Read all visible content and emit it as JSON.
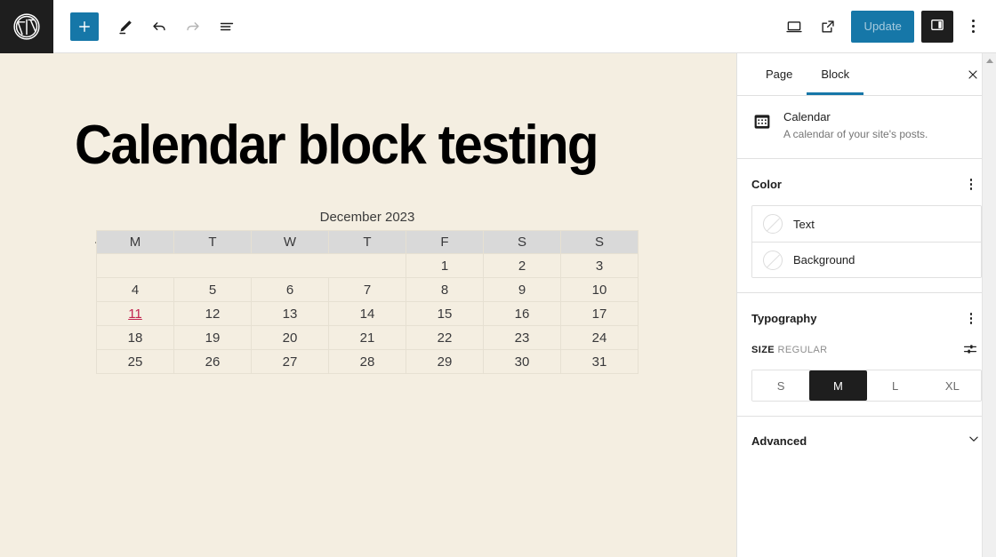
{
  "topbar": {
    "logo_icon": "wordpress-logo-icon",
    "inserter_label": "+",
    "inserter_icon": "plus-icon",
    "tools_icon": "pencil-edit-icon",
    "undo_icon": "undo-arrow-icon",
    "redo_icon": "redo-arrow-icon",
    "list_view_icon": "document-overview-icon",
    "preview_icon": "desktop-preview-icon",
    "view_icon": "external-link-icon",
    "update_label": "Update",
    "sidebar_toggle_icon": "sidebar-panel-icon",
    "options_icon": "three-dots-vertical-icon"
  },
  "canvas": {
    "post_title": "Calendar block testing",
    "paragraph": ".",
    "calendar": {
      "caption": "December 2023",
      "day_headers": [
        "M",
        "T",
        "W",
        "T",
        "F",
        "S",
        "S"
      ],
      "weeks": [
        [
          "",
          "",
          "",
          "",
          "1",
          "2",
          "3"
        ],
        [
          "4",
          "5",
          "6",
          "7",
          "8",
          "9",
          "10"
        ],
        [
          "11",
          "12",
          "13",
          "14",
          "15",
          "16",
          "17"
        ],
        [
          "18",
          "19",
          "20",
          "21",
          "22",
          "23",
          "24"
        ],
        [
          "25",
          "26",
          "27",
          "28",
          "29",
          "30",
          "31"
        ]
      ],
      "linked_day": "11",
      "link_color": "#c2234f",
      "header_bg": "#d9d9d9"
    }
  },
  "sidebar": {
    "tabs": [
      {
        "label": "Page",
        "active": false
      },
      {
        "label": "Block",
        "active": true
      }
    ],
    "close_icon": "close-x-icon",
    "block": {
      "icon": "calendar-icon",
      "name": "Calendar",
      "description": "A calendar of your site's posts."
    },
    "color_panel": {
      "title": "Color",
      "options_icon": "three-dots-vertical-icon",
      "items": [
        {
          "label": "Text",
          "swatch": "none"
        },
        {
          "label": "Background",
          "swatch": "none"
        }
      ]
    },
    "typography_panel": {
      "title": "Typography",
      "options_icon": "three-dots-vertical-icon",
      "size_key": "SIZE",
      "size_value": "REGULAR",
      "slider_icon": "sliders-toggle-icon",
      "sizes": [
        {
          "label": "S",
          "selected": false
        },
        {
          "label": "M",
          "selected": true
        },
        {
          "label": "L",
          "selected": false
        },
        {
          "label": "XL",
          "selected": false
        }
      ]
    },
    "advanced_panel": {
      "title": "Advanced",
      "chevron_icon": "chevron-down-icon"
    }
  },
  "scrollbar": {
    "up_arrow_icon": "scroll-up-arrow-icon"
  },
  "theme": {
    "accent": "#1677a8",
    "canvas_bg": "#f4eee1",
    "dark": "#1e1e1e"
  }
}
